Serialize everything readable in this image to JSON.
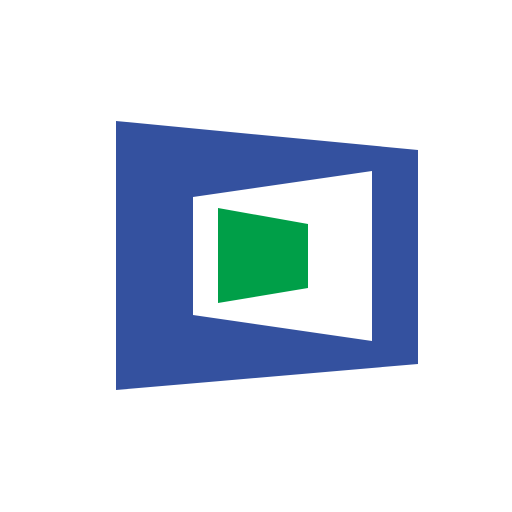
{
  "background_color": "#ffffff",
  "logo": {
    "icon": "perspective-window-logo-icon",
    "colors": {
      "outer_frame": "#34519f",
      "inner_window": "#ffffff",
      "center_panel": "#009f48"
    }
  }
}
